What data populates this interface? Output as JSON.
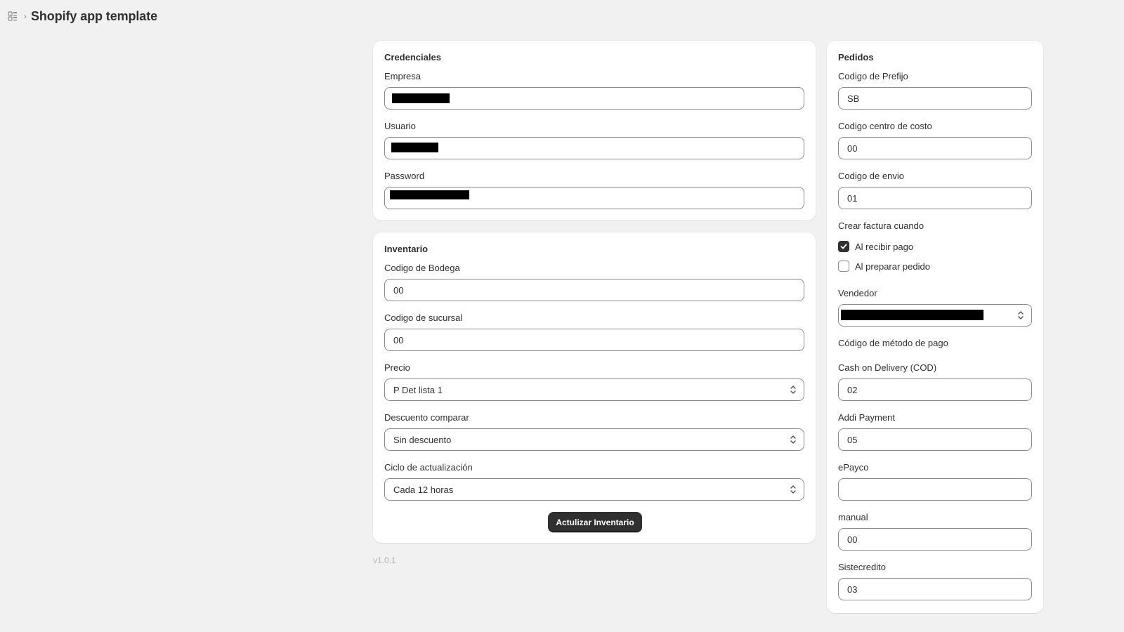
{
  "header": {
    "app_title": "Shopify app template",
    "icon": "app-grid-icon"
  },
  "credenciales": {
    "title": "Credenciales",
    "empresa_label": "Empresa",
    "usuario_label": "Usuario",
    "password_label": "Password"
  },
  "inventario": {
    "title": "Inventario",
    "bodega_label": "Codigo de Bodega",
    "bodega_value": "00",
    "sucursal_label": "Codigo de sucursal",
    "sucursal_value": "00",
    "precio_label": "Precio",
    "precio_value": "P Det lista 1",
    "descuento_label": "Descuento comparar",
    "descuento_value": "Sin descuento",
    "ciclo_label": "Ciclo de actualización",
    "ciclo_value": "Cada 12 horas",
    "update_button": "Actulizar Inventario"
  },
  "pedidos": {
    "title": "Pedidos",
    "prefijo_label": "Codigo de Prefijo",
    "prefijo_value": "SB",
    "centro_costo_label": "Codigo centro de costo",
    "centro_costo_value": "00",
    "envio_label": "Codigo de envio",
    "envio_value": "01",
    "factura_label": "Crear factura cuando",
    "option_recibir_pago": "Al recibir pago",
    "option_recibir_pago_checked": true,
    "option_preparar_pedido": "Al preparar pedido",
    "option_preparar_pedido_checked": false,
    "vendedor_label": "Vendedor",
    "metodo_pago_label": "Código de método de pago",
    "cod_label": "Cash on Delivery (COD)",
    "cod_value": "02",
    "addi_label": "Addi Payment",
    "addi_value": "05",
    "epayco_label": "ePayco",
    "epayco_value": "",
    "manual_label": "manual",
    "manual_value": "00",
    "sistecredito_label": "Sistecredito",
    "sistecredito_value": "03"
  },
  "footer": {
    "version": "v1.0.1"
  },
  "colors": {
    "background": "#f1f1f1",
    "card": "#ffffff",
    "primary_button": "#303030",
    "border": "#8a8a8a"
  }
}
